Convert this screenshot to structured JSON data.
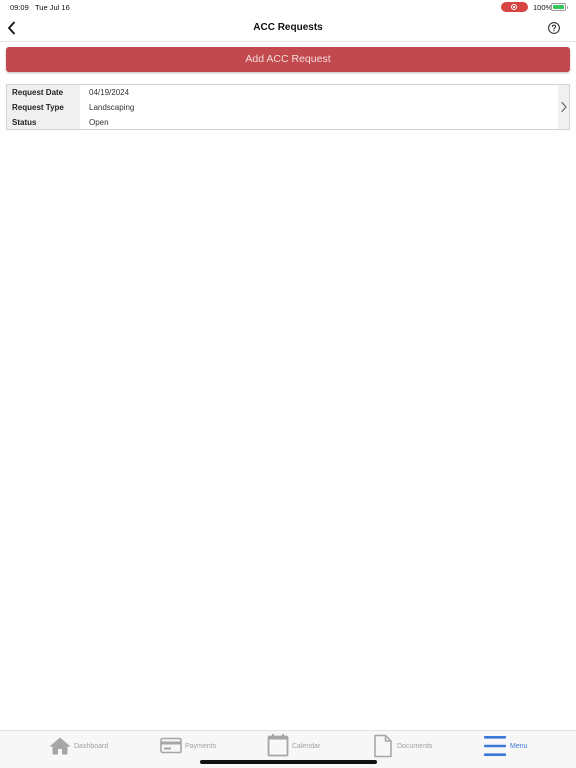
{
  "status_bar": {
    "time": "09:09",
    "date": "Tue Jul 16",
    "battery_percent": "100%",
    "recording_color": "#d64541"
  },
  "nav": {
    "title": "ACC Requests",
    "back_icon": "chevron-left-icon",
    "help_icon": "question-circle-icon"
  },
  "actions": {
    "add_label": "Add ACC Request",
    "accent_color": "#c2494e"
  },
  "requests": [
    {
      "fields": [
        {
          "label": "Request Date",
          "value": "04/19/2024"
        },
        {
          "label": "Request Type",
          "value": "Landscaping"
        },
        {
          "label": "Status",
          "value": "Open"
        }
      ]
    }
  ],
  "tab_bar": {
    "active_color": "#3a78d8",
    "inactive_color": "#a0a0a0",
    "tabs": [
      {
        "label": "Dashboard",
        "icon": "home-icon",
        "active": false
      },
      {
        "label": "Payments",
        "icon": "credit-card-icon",
        "active": false
      },
      {
        "label": "Calendar",
        "icon": "calendar-icon",
        "active": false
      },
      {
        "label": "Documents",
        "icon": "document-icon",
        "active": false
      },
      {
        "label": "Menu",
        "icon": "menu-icon",
        "active": true
      }
    ]
  }
}
